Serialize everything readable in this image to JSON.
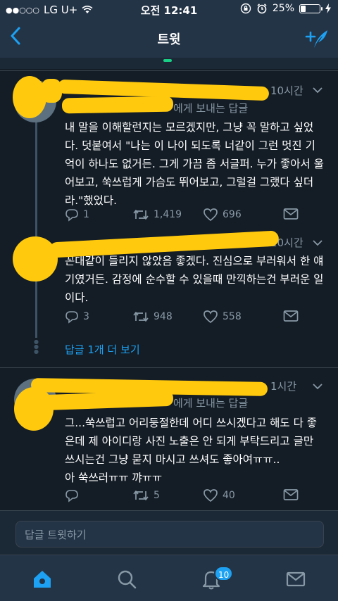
{
  "status_bar": {
    "carrier": "LG U+",
    "time": "오전 12:41",
    "battery": "25%"
  },
  "nav": {
    "title": "트윗"
  },
  "tweets": [
    {
      "time": "10시간",
      "replying_to": "에게 보내는 답글",
      "text": "내 말을 이해할런지는 모르겠지만, 그냥 꼭 말하고 싶었다. 덧붙여서 \"나는 이 나이 되도록 너같이 그런 멋진 기억이 하나도 없거든. 그게 가끔 좀 서글퍼. 누가 좋아서 울어보고, 쑥쓰럽게 가슴도 뛰어보고, 그럴걸 그랬다 싶더라.\"했었다.",
      "replies": "1",
      "retweets": "1,419",
      "likes": "696"
    },
    {
      "time": "10시간",
      "text": "꼰대같이 들리지 않았음 좋겠다. 진심으로 부러워서 한 얘기였거든. 감정에 순수할 수 있을때 만끽하는건 부러운 일이다.",
      "replies": "3",
      "retweets": "948",
      "likes": "558"
    },
    {
      "time": "1시간",
      "replying_to": "에게 보내는 답글",
      "text": "그...쑥쓰럽고 어리둥절한데 어디 쓰시겠다고 해도 다 좋은데 제 아이디랑 사진 노출은 안 되게 부탁드리고 글만 쓰시는건 그냥 묻지 마시고 쓰셔도 좋아여ㅠㅠ..\n아 쑥쓰러ㅠㅠ 꺄ㅠㅠ",
      "replies": "",
      "retweets": "5",
      "likes": "40"
    }
  ],
  "show_more": "답글 1개 더 보기",
  "reply_placeholder": "답글 트윗하기",
  "tab_bar": {
    "notifications_badge": "10",
    "items": [
      "home-icon",
      "search-icon",
      "notifications-icon",
      "messages-icon"
    ]
  },
  "colors": {
    "background": "#141d26",
    "bar": "#243447",
    "accent": "#1da1f2",
    "muted": "#8899a6",
    "redaction": "#ffc90e"
  }
}
